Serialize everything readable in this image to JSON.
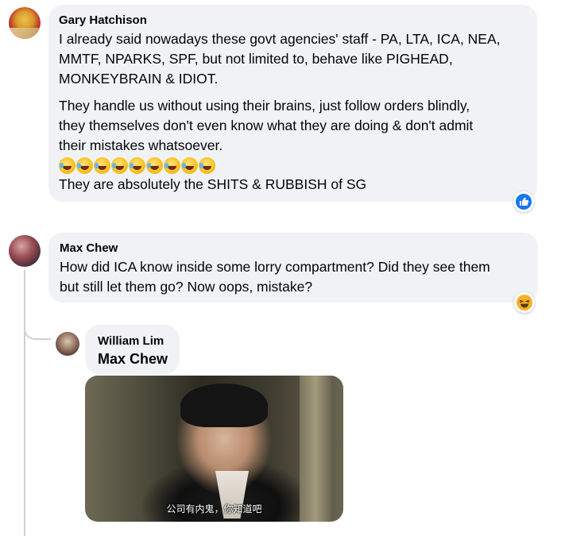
{
  "comments": [
    {
      "author": "Gary Hatchison",
      "paragraphs": [
        [
          "I already said nowadays these govt agencies' staff - PA, LTA, ICA, NEA,",
          "MMTF, NPARKS, SPF, but not limited to, behave like PIGHEAD,",
          "MONKEYBRAIN & IDIOT."
        ],
        [
          "They handle us without using their brains, just follow orders blindly,",
          "they themselves don't even know what they are doing & don't admit",
          "their mistakes whatsoever."
        ]
      ],
      "emoji_count": 9,
      "emoji_name": "rolling-on-floor-laughing-emoji",
      "closing_line": "They are absolutely the SHITS & RUBBISH of SG",
      "reaction_icon": "like-reaction-icon",
      "reaction_color": "#1877f2"
    },
    {
      "author": "Max Chew",
      "lines": [
        "How did ICA know inside some lorry compartment? Did they see them",
        "but still let them go? Now oops, mistake?"
      ],
      "reaction_icon": "haha-reaction-icon",
      "reaction_color": "#f7b125"
    }
  ],
  "reply": {
    "author": "William Lim",
    "mention": "Max Chew",
    "gif_subtitle": "公司有内鬼，你知道吧"
  }
}
